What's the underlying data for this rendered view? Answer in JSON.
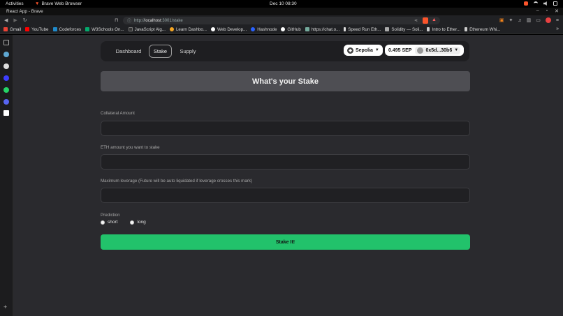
{
  "os_bar": {
    "activities": "Activities",
    "app_name": "Brave Web Browser",
    "clock": "Dec 10  08:30"
  },
  "window": {
    "title": "React App - Brave"
  },
  "browser": {
    "url_prefix": "http://",
    "url_host": "localhost",
    "url_rest": ":3001/stake"
  },
  "bookmarks": [
    {
      "label": "Gmail",
      "color": "#ea4335"
    },
    {
      "label": "YouTube",
      "color": "#ff0000"
    },
    {
      "label": "Codeforces",
      "color": "#1f8acb"
    },
    {
      "label": "W3Schools On...",
      "color": "#04aa6d"
    },
    {
      "label": "JavaScript Alg...",
      "color": "#333333"
    },
    {
      "label": "Learn Dashbo...",
      "color": "#f5a623"
    },
    {
      "label": "Web Develop...",
      "color": "#ffffff"
    },
    {
      "label": "Hashnode",
      "color": "#2962ff"
    },
    {
      "label": "GitHub",
      "color": "#ffffff"
    },
    {
      "label": "https://chat.o...",
      "color": "#74aa9c"
    },
    {
      "label": "Speed Run Eth...",
      "color": "#dddddd"
    },
    {
      "label": "Solidity — Soli...",
      "color": "#aaaaaa"
    },
    {
      "label": "Intro to Ether...",
      "color": "#cccccc"
    },
    {
      "label": "Ethereum Whi...",
      "color": "#cccccc"
    }
  ],
  "nav": {
    "links": [
      "Dashboard",
      "Stake",
      "Supply"
    ],
    "active": "Stake",
    "network": "Sepolia",
    "balance": "0.495 SEP",
    "account": "0x5d...30b6"
  },
  "page": {
    "heading": "What's your Stake",
    "fields": [
      {
        "label": "Collateral Amount",
        "value": ""
      },
      {
        "label": "ETH amount you want to stake",
        "value": ""
      },
      {
        "label": "Maximum leverage (Future will be auto liquidated if leverage crosses this mark)",
        "value": ""
      }
    ],
    "prediction_label": "Prediction",
    "options": [
      "short",
      "long"
    ],
    "submit": "Stake It!"
  },
  "colors": {
    "accent_green": "#22c26b",
    "page_bg": "#2a2a2e"
  }
}
